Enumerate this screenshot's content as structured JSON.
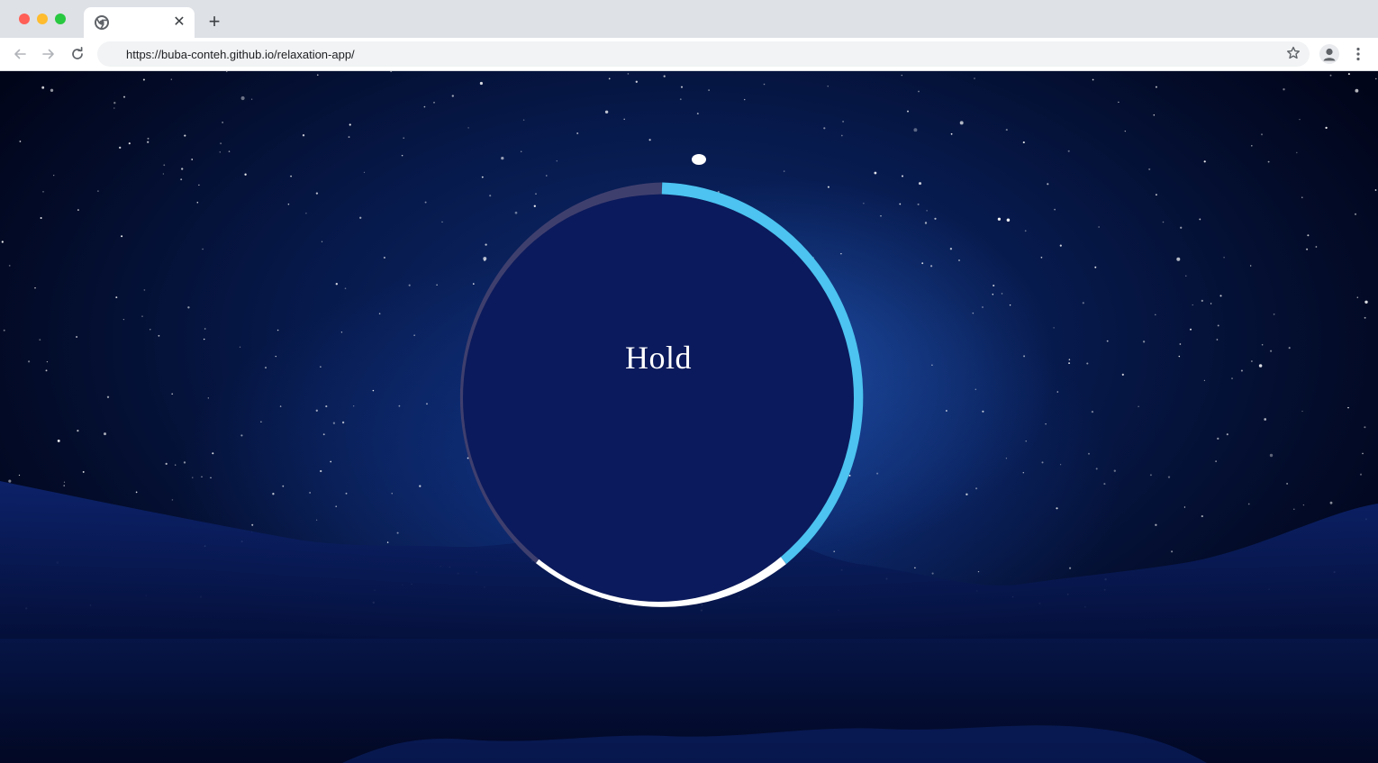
{
  "browser": {
    "url": "https://buba-conteh.github.io/relaxation-app/",
    "tab_close_symbol": "✕",
    "new_tab_symbol": "+",
    "icons": [
      "chrome-favicon-icon",
      "close-icon",
      "plus-icon",
      "back-arrow-icon",
      "forward-arrow-icon",
      "reload-icon",
      "star-icon",
      "profile-icon",
      "kebab-menu-icon"
    ]
  },
  "app": {
    "breath_text": "Hold",
    "colors": {
      "inhale_segment": "#4cc3f0",
      "hold_segment": "#ffffff",
      "exhale_segment": "#3f3f6e",
      "inner_circle": "#0b1a5c"
    }
  }
}
